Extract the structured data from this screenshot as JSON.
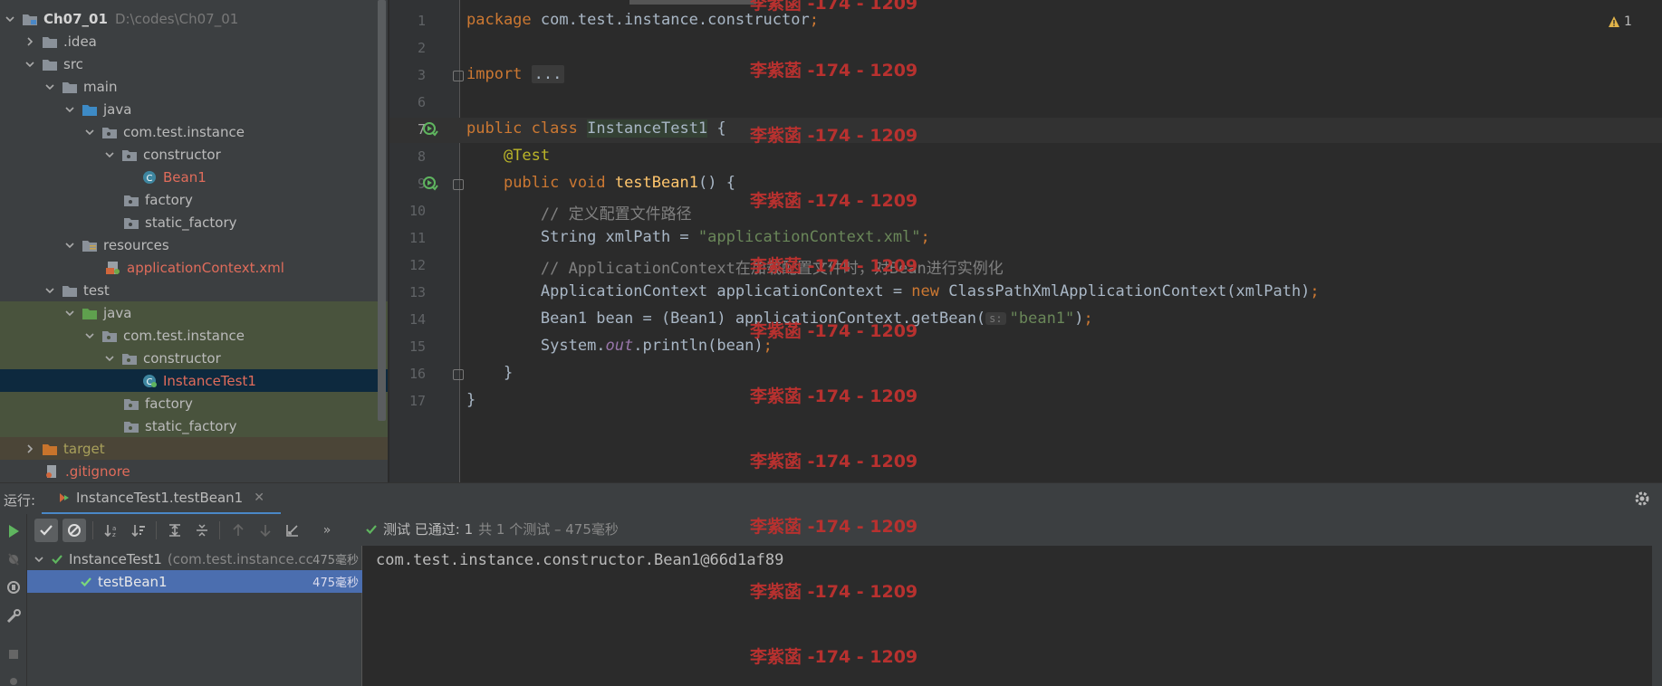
{
  "project_tree": {
    "items": [
      {
        "label": "Ch07_01",
        "path": "D:\\codes\\Ch07_01"
      },
      {
        "label": ".idea"
      },
      {
        "label": "src"
      },
      {
        "label": "main"
      },
      {
        "label": "java"
      },
      {
        "label": "com.test.instance"
      },
      {
        "label": "constructor"
      },
      {
        "label": "Bean1"
      },
      {
        "label": "factory"
      },
      {
        "label": "static_factory"
      },
      {
        "label": "resources"
      },
      {
        "label": "applicationContext.xml"
      },
      {
        "label": "test"
      },
      {
        "label": "java"
      },
      {
        "label": "com.test.instance"
      },
      {
        "label": "constructor"
      },
      {
        "label": "InstanceTest1"
      },
      {
        "label": "factory"
      },
      {
        "label": "static_factory"
      },
      {
        "label": "target"
      },
      {
        "label": ".gitignore"
      }
    ]
  },
  "editor": {
    "line_numbers": [
      "1",
      "2",
      "3",
      "6",
      "7",
      "8",
      "9",
      "10",
      "11",
      "12",
      "13",
      "14",
      "15",
      "16",
      "17"
    ],
    "tokens": {
      "package_kw": "package",
      "package_name": "com.test.instance.constructor",
      "semi": ";",
      "import_kw": "import",
      "import_fold": "...",
      "public": "public",
      "class": "class",
      "class_name": "InstanceTest1",
      "open_brace": "{",
      "close_brace": "}",
      "annotation": "@Test",
      "void": "void",
      "method_name": "testBean1",
      "method_parens": "()",
      "comment1": "// 定义配置文件路径",
      "string_type": "String xmlPath = ",
      "xml_path": "\"applicationContext.xml\"",
      "comment2": "// ApplicationContext在加载配置文件时，对Bean进行实例化",
      "app_ctx_decl": "ApplicationContext applicationContext = ",
      "new_kw": "new",
      "app_ctx_ctor": " ClassPathXmlApplicationContext(xmlPath)",
      "bean_decl": "Bean1 bean = (Bean1) applicationContext.getBean(",
      "param_hint": "s:",
      "bean_name": "\"bean1\"",
      "close_paren": ")",
      "system": "System.",
      "out": "out",
      "println": ".println(bean)"
    },
    "warning_count": "1"
  },
  "watermark": "李紫菡 -174 - 1209",
  "run_panel": {
    "label": "运行:",
    "tab_label": "InstanceTest1.testBean1",
    "status_passed": "测试 已通过: 1",
    "status_detail": "共 1 个测试 – 475毫秒",
    "tests": [
      {
        "name": "InstanceTest1",
        "package": "(com.test.instance.cc",
        "time": "475毫秒"
      },
      {
        "name": "testBean1",
        "time": "475毫秒"
      }
    ],
    "console_output": "com.test.instance.constructor.Bean1@66d1af89"
  },
  "colors": {
    "accent": "#4a88c7",
    "pass_green": "#5fb55f",
    "watermark_red": "#b8312f"
  }
}
